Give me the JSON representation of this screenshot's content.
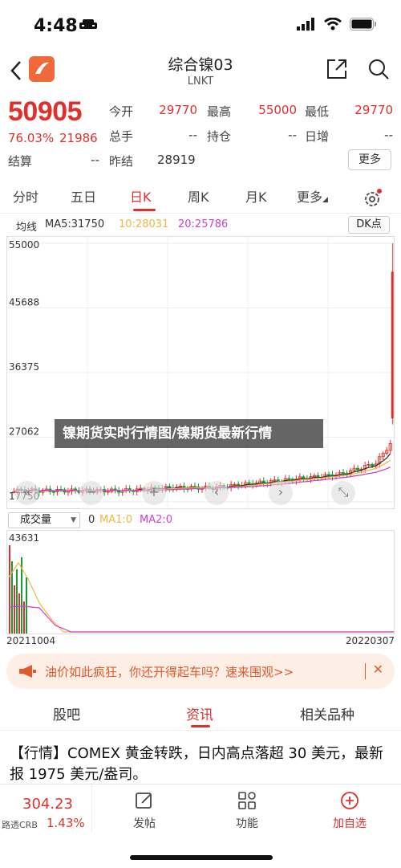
{
  "status_bar": {
    "time": "4:48"
  },
  "nav": {
    "title": "综合镍03",
    "subtitle": "LNKT"
  },
  "quote": {
    "price": "50905",
    "change_pct": "76.03%",
    "change": "21986",
    "open_label": "今开",
    "open": "29770",
    "high_label": "最高",
    "high": "55000",
    "low_label": "最低",
    "low": "29770",
    "volume_label": "总手",
    "volume": "--",
    "oi_label": "持仓",
    "oi": "--",
    "daily_inc_label": "日增",
    "daily_inc": "--",
    "settle_label": "结算",
    "settle": "--",
    "prev_settle_label": "昨结",
    "prev_settle": "28919",
    "more_label": "更多"
  },
  "tabs": [
    "分时",
    "五日",
    "日K",
    "周K",
    "月K",
    "更多"
  ],
  "active_tab": "日K",
  "ma": {
    "label": "均线",
    "ma5": "MA5:31750",
    "ma10": "10:28031",
    "ma20": "20:25786",
    "dk_label": "DK点",
    "colors": {
      "ma5": "#333333",
      "ma10": "#f0b840",
      "ma20": "#d040d0"
    }
  },
  "chart_data": {
    "type": "candlestick",
    "y_ticks": [
      "55000",
      "45688",
      "36375",
      "27062",
      "17750"
    ],
    "ylim": [
      17750,
      55000
    ],
    "start_date": "20211004",
    "end_date": "20220307"
  },
  "volume": {
    "selector": "成交量",
    "value": "0",
    "ma1": "MA1:0",
    "ma2": "MA2:0",
    "max": "43631"
  },
  "watermark": "镍期货实时行情图/镍期货最新行情",
  "ad": {
    "text": "油价如此疯狂，你还开得起车吗？速来围观>>",
    "close": "✕"
  },
  "sub_tabs": [
    "股吧",
    "资讯",
    "相关品种"
  ],
  "active_sub_tab": "资讯",
  "news": "【行情】COMEX 黄金转跌，日内高点落超 30 美元，最新报 1975 美元/盎司。",
  "bottom": {
    "price": "304.23",
    "name": "路透CRB",
    "pct": "1.43%",
    "post": "发帖",
    "func": "功能",
    "add": "加自选"
  },
  "colors": {
    "accent": "#e0302c",
    "brand_logo": "#ee6a3a"
  }
}
